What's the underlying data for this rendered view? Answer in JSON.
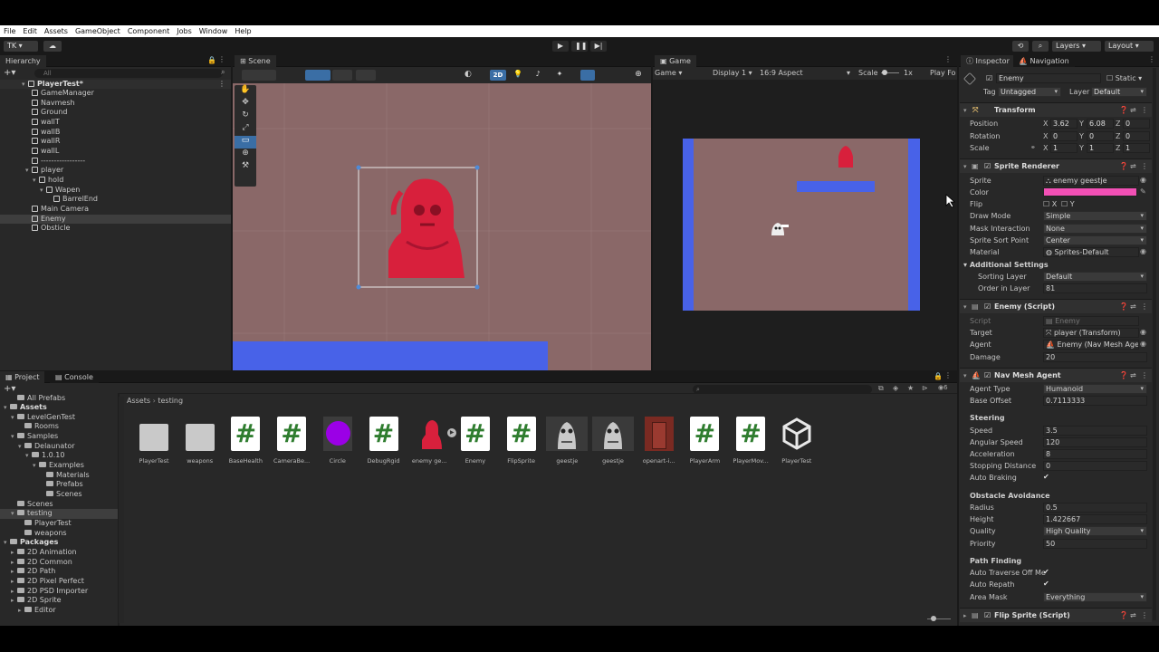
{
  "menu": [
    "File",
    "Edit",
    "Assets",
    "GameObject",
    "Component",
    "Jobs",
    "Window",
    "Help"
  ],
  "toolbar": {
    "account": "TK ▾",
    "layers": "Layers",
    "layout": "Layout"
  },
  "hierarchy": {
    "tab": "Hierarchy",
    "search_placeholder": "All",
    "scene": "PlayerTest*",
    "items": [
      "GameManager",
      "Navmesh",
      "Ground",
      "wallT",
      "wallB",
      "wallR",
      "wallL",
      "-----------------",
      "player",
      "hold",
      "Wapen",
      "BarrelEnd",
      "Main Camera",
      "Enemy",
      "Obsticle"
    ]
  },
  "scene_view": {
    "tab": "Scene",
    "mode_2d": "2D"
  },
  "game_view": {
    "tab": "Game",
    "display_type": "Game",
    "display": "Display 1",
    "aspect": "16:9 Aspect",
    "scale_label": "Scale",
    "scale_value": "1x",
    "play_focused": "Play Fo"
  },
  "inspector": {
    "tabs": [
      "Inspector",
      "Navigation"
    ],
    "object_name": "Enemy",
    "static_label": "Static",
    "tag_label": "Tag",
    "tag": "Untagged",
    "layer_label": "Layer",
    "layer": "Default",
    "transform": {
      "title": "Transform",
      "position": "Position",
      "rotation": "Rotation",
      "scale": "Scale",
      "pos": {
        "x": "3.62",
        "y": "6.08",
        "z": "0"
      },
      "rot": {
        "x": "0",
        "y": "0",
        "z": "0"
      },
      "scl": {
        "x": "1",
        "y": "1",
        "z": "1"
      }
    },
    "sprite_renderer": {
      "title": "Sprite Renderer",
      "sprite_label": "Sprite",
      "sprite": "enemy geestje",
      "color_label": "Color",
      "color_hex": "#f250b5",
      "flip_label": "Flip",
      "flip_x": "X",
      "flip_y": "Y",
      "draw_mode_label": "Draw Mode",
      "draw_mode": "Simple",
      "mask_label": "Mask Interaction",
      "mask": "None",
      "sort_point_label": "Sprite Sort Point",
      "sort_point": "Center",
      "material_label": "Material",
      "material": "Sprites-Default",
      "additional": "Additional Settings",
      "sorting_layer_label": "Sorting Layer",
      "sorting_layer": "Default",
      "order_label": "Order in Layer",
      "order": "81"
    },
    "enemy_script": {
      "title": "Enemy (Script)",
      "script_label": "Script",
      "script": "Enemy",
      "target_label": "Target",
      "target": "player (Transform)",
      "agent_label": "Agent",
      "agent": "Enemy (Nav Mesh Agent)",
      "damage_label": "Damage",
      "damage": "20"
    },
    "nav_agent": {
      "title": "Nav Mesh Agent",
      "agent_type_label": "Agent Type",
      "agent_type": "Humanoid",
      "base_offset_label": "Base Offset",
      "base_offset": "0.7113333",
      "steering": "Steering",
      "speed_label": "Speed",
      "speed": "3.5",
      "ang_label": "Angular Speed",
      "ang": "120",
      "acc_label": "Acceleration",
      "acc": "8",
      "stop_label": "Stopping Distance",
      "stop": "0",
      "brake_label": "Auto Braking",
      "obstacle": "Obstacle Avoidance",
      "radius_label": "Radius",
      "radius": "0.5",
      "height_label": "Height",
      "height": "1.422667",
      "quality_label": "Quality",
      "quality": "High Quality",
      "priority_label": "Priority",
      "priority": "50",
      "path": "Path Finding",
      "traverse_label": "Auto Traverse Off Me",
      "repath_label": "Auto Repath",
      "area_label": "Area Mask",
      "area": "Everything"
    },
    "flip_script": {
      "title": "Flip Sprite (Script)"
    }
  },
  "project": {
    "tabs": [
      "Project",
      "Console"
    ],
    "breadcrumb": [
      "Assets",
      "testing"
    ],
    "tree": [
      {
        "t": "All Prefabs",
        "d": 1
      },
      {
        "t": "Assets",
        "d": 0,
        "bold": true
      },
      {
        "t": "LevelGenTest",
        "d": 1
      },
      {
        "t": "Rooms",
        "d": 2
      },
      {
        "t": "Samples",
        "d": 1
      },
      {
        "t": "Delaunator",
        "d": 2
      },
      {
        "t": "1.0.10",
        "d": 3
      },
      {
        "t": "Examples",
        "d": 4
      },
      {
        "t": "Materials",
        "d": 5
      },
      {
        "t": "Prefabs",
        "d": 5
      },
      {
        "t": "Scenes",
        "d": 5
      },
      {
        "t": "Scenes",
        "d": 1
      },
      {
        "t": "testing",
        "d": 1,
        "sel": true
      },
      {
        "t": "PlayerTest",
        "d": 2
      },
      {
        "t": "weapons",
        "d": 2
      },
      {
        "t": "Packages",
        "d": 0,
        "bold": true
      },
      {
        "t": "2D Animation",
        "d": 1
      },
      {
        "t": "2D Common",
        "d": 1
      },
      {
        "t": "2D Path",
        "d": 1
      },
      {
        "t": "2D Pixel Perfect",
        "d": 1
      },
      {
        "t": "2D PSD Importer",
        "d": 1
      },
      {
        "t": "2D Sprite",
        "d": 1
      },
      {
        "t": "Editor",
        "d": 2
      }
    ],
    "assets": [
      {
        "label": "PlayerTest",
        "kind": "folder"
      },
      {
        "label": "weapons",
        "kind": "folder"
      },
      {
        "label": "BaseHealth",
        "kind": "script"
      },
      {
        "label": "CameraBe...",
        "kind": "script"
      },
      {
        "label": "Circle",
        "kind": "circle"
      },
      {
        "label": "DebugRgid",
        "kind": "script"
      },
      {
        "label": "enemy ge...",
        "kind": "enemy"
      },
      {
        "label": "Enemy",
        "kind": "script"
      },
      {
        "label": "FlipSprite",
        "kind": "script"
      },
      {
        "label": "geestje",
        "kind": "ghost"
      },
      {
        "label": "geestje",
        "kind": "ghost"
      },
      {
        "label": "openart-i...",
        "kind": "door"
      },
      {
        "label": "PlayerArm",
        "kind": "script"
      },
      {
        "label": "PlayerMov...",
        "kind": "script"
      },
      {
        "label": "PlayerTest",
        "kind": "unity"
      }
    ]
  },
  "colors": {
    "scene_bg": "#8a6868",
    "wall_blue": "#4862e8",
    "enemy_red": "#d8203c",
    "highlight_blue": "#3a6ea5"
  }
}
